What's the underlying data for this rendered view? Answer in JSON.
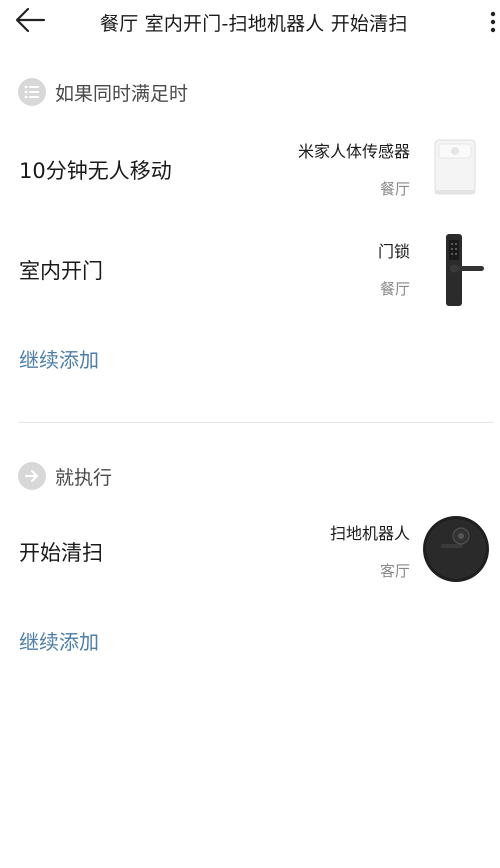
{
  "header": {
    "title": "餐厅 室内开门-扫地机器人 开始清扫"
  },
  "conditions": {
    "label": "如果同时满足时",
    "icon": "list-icon",
    "items": [
      {
        "title": "10分钟无人移动",
        "device": "米家人体传感器",
        "room": "餐厅",
        "image": "motion-sensor"
      },
      {
        "title": "室内开门",
        "device": "门锁",
        "room": "餐厅",
        "image": "door-lock"
      }
    ],
    "add_label": "继续添加"
  },
  "actions": {
    "label": "就执行",
    "icon": "arrow-right-icon",
    "items": [
      {
        "title": "开始清扫",
        "device": "扫地机器人",
        "room": "客厅",
        "image": "robot-vacuum"
      }
    ],
    "add_label": "继续添加"
  },
  "colors": {
    "link": "#4d7ea8",
    "icon_bg": "#d8d8d8",
    "divider": "#e6e6e6",
    "secondary_text": "#8a8a8a"
  }
}
